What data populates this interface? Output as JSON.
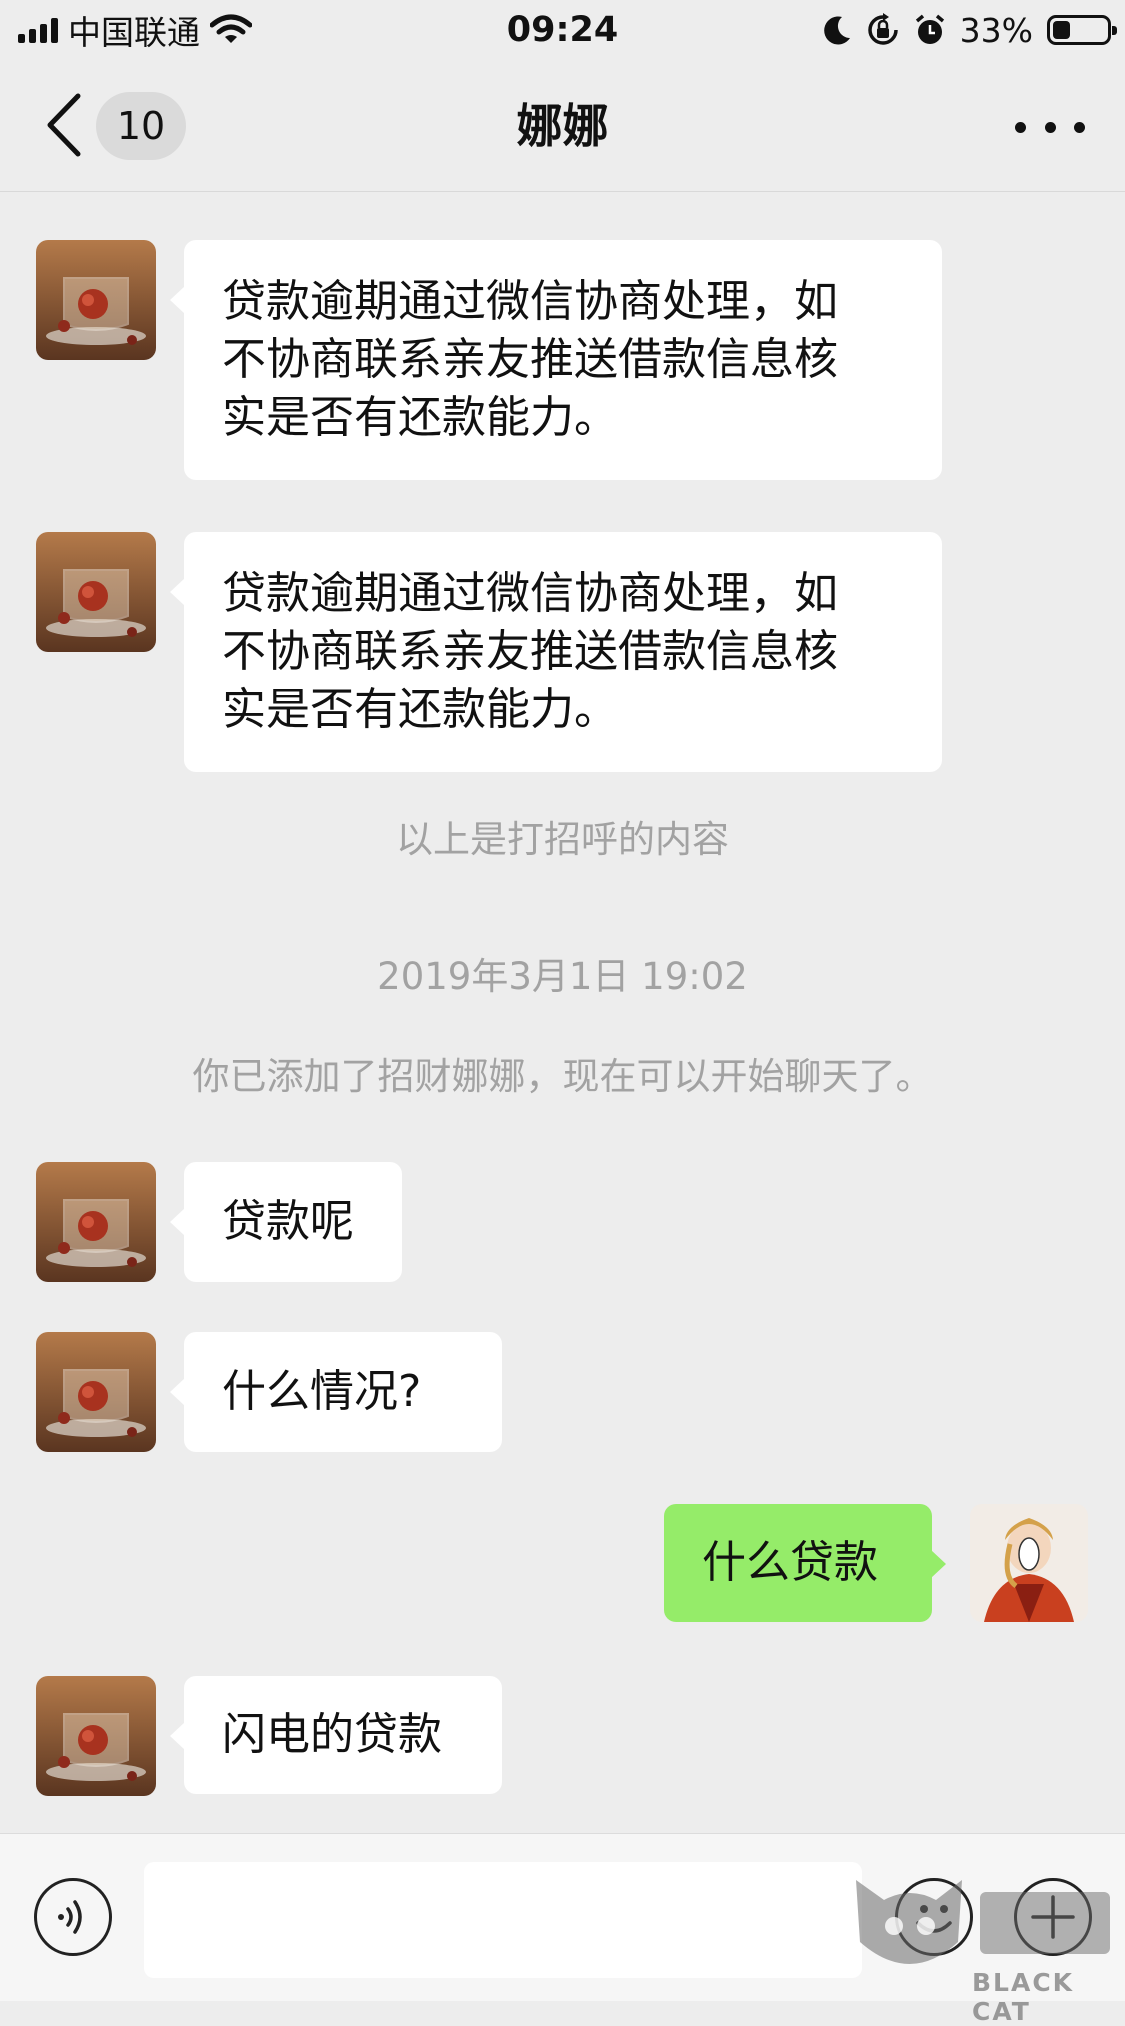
{
  "status_bar": {
    "carrier": "中国联通",
    "time": "09:24",
    "battery_percent": "33%",
    "battery_level": 0.33,
    "icons": [
      "signal-icon",
      "wifi-icon",
      "moon-icon",
      "rotation-lock-icon",
      "alarm-icon",
      "battery-icon"
    ]
  },
  "nav": {
    "back_icon": "chevron-left-icon",
    "unread_count": "10",
    "title": "娜娜",
    "more_icon": "more-dots-icon"
  },
  "messages": [
    {
      "sender": "contact",
      "text": "贷款逾期通过微信协商处理，如\n不协商联系亲友推送借款信息核\n实是否有还款能力。"
    },
    {
      "sender": "contact",
      "text": "贷款逾期通过微信协商处理，如\n不协商联系亲友推送借款信息核\n实是否有还款能力。"
    },
    {
      "sender": "system",
      "text": "以上是打招呼的内容"
    },
    {
      "sender": "system",
      "text": "2019年3月1日 19:02"
    },
    {
      "sender": "system",
      "text": "你已添加了招财娜娜，现在可以开始聊天了。"
    },
    {
      "sender": "contact",
      "text": "贷款呢"
    },
    {
      "sender": "contact",
      "text": "什么情况?"
    },
    {
      "sender": "me",
      "text": "什么贷款"
    },
    {
      "sender": "contact",
      "text": "闪电的贷款"
    }
  ],
  "input_bar": {
    "voice_icon": "voice-icon",
    "text_value": "",
    "emoji_icon": "emoji-icon",
    "plus_icon": "plus-icon"
  },
  "watermark": {
    "text": "BLACK CAT"
  },
  "colors": {
    "background": "#ededed",
    "my_bubble": "#95ec69",
    "contact_bubble": "#ffffff",
    "system_text": "#a2a2a2"
  }
}
